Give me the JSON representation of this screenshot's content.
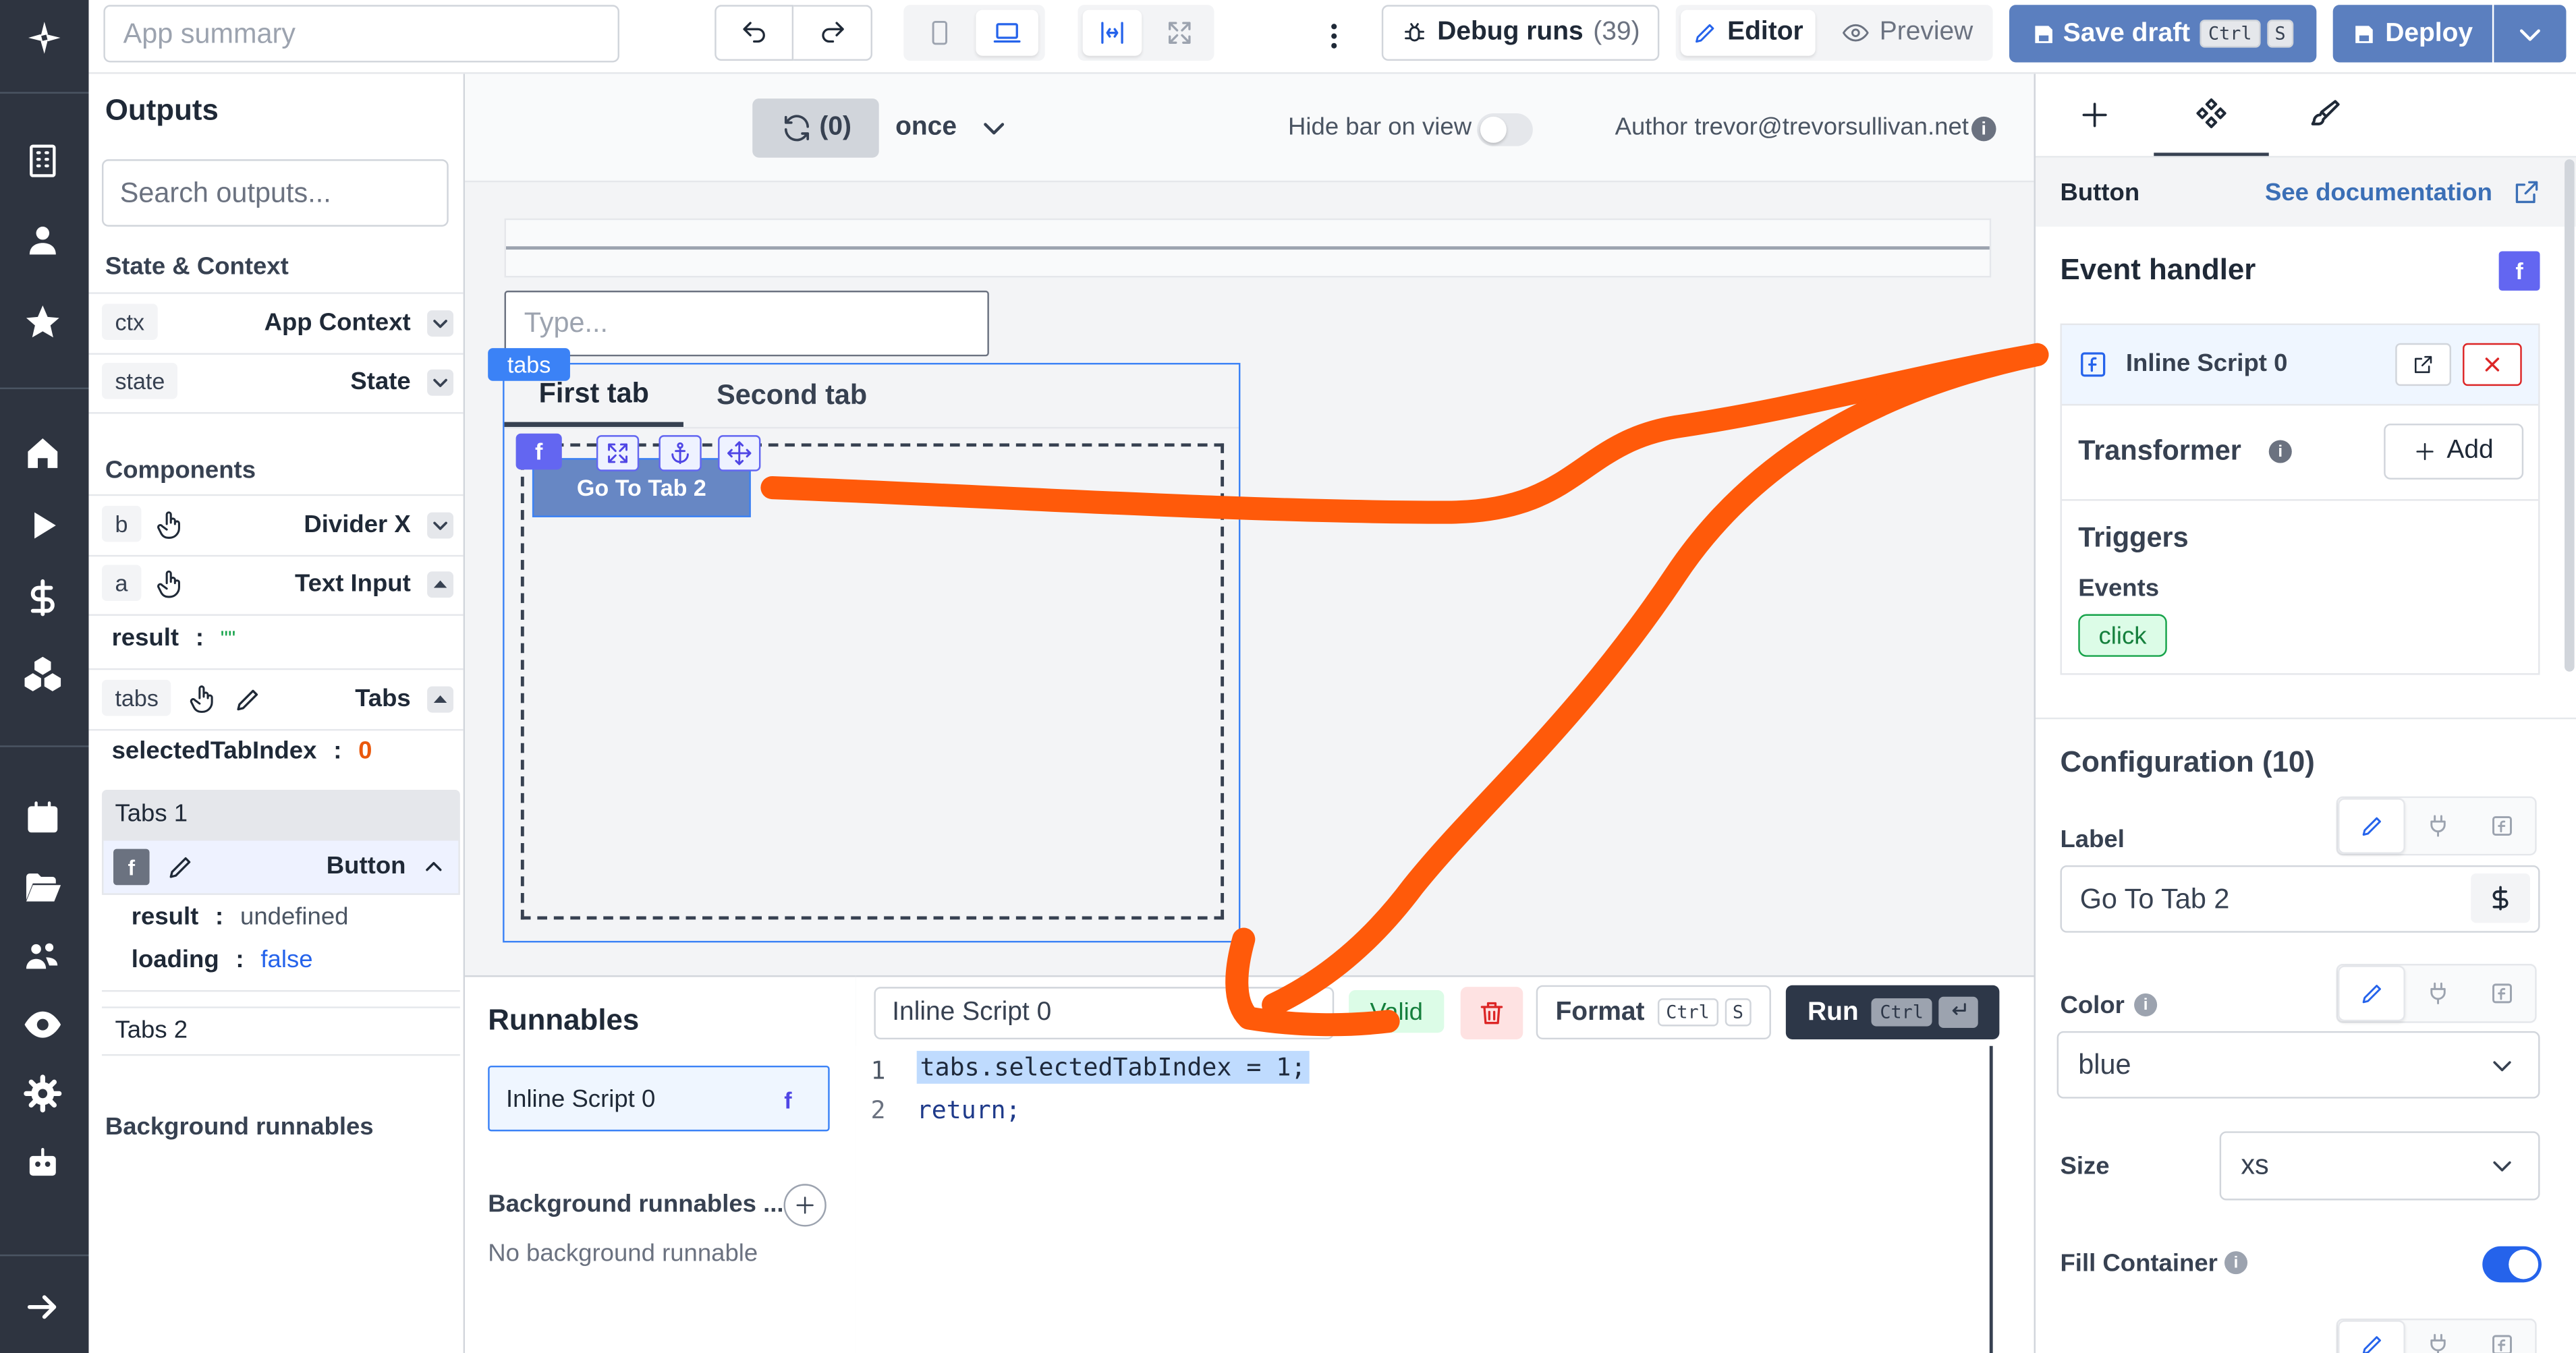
{
  "topbar": {
    "app_summary_placeholder": "App summary",
    "debug_runs_label": "Debug runs",
    "debug_runs_count": "(39)",
    "editor_label": "Editor",
    "preview_label": "Preview",
    "save_draft_label": "Save draft",
    "save_draft_kbd1": "Ctrl",
    "save_draft_kbd2": "S",
    "deploy_label": "Deploy"
  },
  "outputs": {
    "title": "Outputs",
    "search_placeholder": "Search outputs...",
    "state_context_header": "State & Context",
    "ctx_tag": "ctx",
    "ctx_label": "App Context",
    "state_tag": "state",
    "state_label": "State",
    "components_header": "Components",
    "b_tag": "b",
    "b_label": "Divider X",
    "a_tag": "a",
    "a_label": "Text Input",
    "a_result_key": "result",
    "a_result_val": "\"\"",
    "tabs_tag": "tabs",
    "tabs_label": "Tabs",
    "tabs_key": "selectedTabIndex",
    "tabs_val": "0",
    "tabs1_label": "Tabs 1",
    "f_tag": "f",
    "button_label": "Button",
    "btn_result_key": "result",
    "btn_result_val": "undefined",
    "btn_loading_key": "loading",
    "btn_loading_val": "false",
    "tabs2_label": "Tabs 2",
    "bg_runnables_label": "Background runnables",
    "colon": ":"
  },
  "canvas": {
    "refresh_count": "(0)",
    "once_label": "once",
    "hide_bar_label": "Hide bar on view",
    "author_label": "Author trevor@trevorsullivan.net",
    "text_input_placeholder": "Type...",
    "tabs_badge": "tabs",
    "tab1": "First tab",
    "tab2": "Second tab",
    "f_badge": "f",
    "button_text": "Go To Tab 2"
  },
  "runnables": {
    "title": "Runnables",
    "item_label": "Inline Script 0",
    "item_badge": "f",
    "bg_label": "Background runnables ...",
    "no_bg": "No background runnable"
  },
  "editor": {
    "script_name": "Inline Script 0",
    "valid_label": "Valid",
    "format_label": "Format",
    "format_kbd1": "Ctrl",
    "format_kbd2": "S",
    "run_label": "Run",
    "run_kbd": "Ctrl",
    "line1_no": "1",
    "line2_no": "2",
    "line1_code": "tabs.selectedTabIndex = 1;",
    "line2_code": "return;"
  },
  "right": {
    "component_label": "Button",
    "see_doc_label": "See documentation",
    "event_handler_title": "Event handler",
    "f_badge": "f",
    "inline_script_label": "Inline Script 0",
    "transformer_label": "Transformer",
    "add_label": "Add",
    "triggers_label": "Triggers",
    "events_label": "Events",
    "event_click": "click",
    "config_title": "Configuration (10)",
    "label_label": "Label",
    "label_value": "Go To Tab 2",
    "color_label": "Color",
    "color_value": "blue",
    "size_label": "Size",
    "size_value": "xs",
    "fill_container_label": "Fill Container"
  },
  "annotation_color": "#ff5a0a",
  "accent_color": "#2563eb",
  "save_button_color": "#5b7fbf"
}
